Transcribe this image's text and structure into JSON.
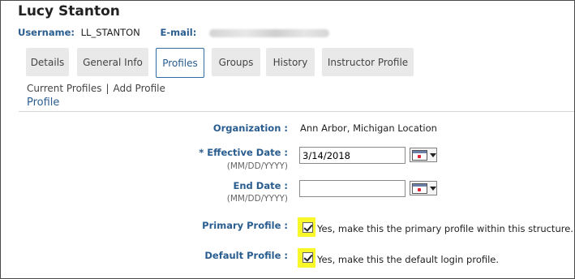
{
  "header": {
    "title": "Lucy Stanton",
    "username_label": "Username:",
    "username_value": "LL_STANTON",
    "email_label": "E-mail:"
  },
  "tabs": [
    {
      "label": "Details",
      "active": false
    },
    {
      "label": "General Info",
      "active": false
    },
    {
      "label": "Profiles",
      "active": true
    },
    {
      "label": "Groups",
      "active": false
    },
    {
      "label": "History",
      "active": false
    },
    {
      "label": "Instructor Profile",
      "active": false
    }
  ],
  "subnav": {
    "current": "Current Profiles",
    "separator": "|",
    "add": "Add Profile"
  },
  "section_title": "Profile",
  "form": {
    "organization": {
      "label": "Organization :",
      "value": "Ann Arbor, Michigan Location"
    },
    "effective_date": {
      "label": "* Effective Date :",
      "hint": "(MM/DD/YYYY)",
      "value": "3/14/2018"
    },
    "end_date": {
      "label": "End Date :",
      "hint": "(MM/DD/YYYY)",
      "value": ""
    },
    "primary_profile": {
      "label": "Primary Profile :",
      "checked": true,
      "text": "Yes, make this the primary profile within this structure."
    },
    "default_profile": {
      "label": "Default Profile :",
      "checked": true,
      "text": "Yes, make this the default login profile."
    }
  },
  "colors": {
    "accent": "#2a5d8f",
    "highlight": "#f7f72a",
    "tab_bg": "#e9e9e9"
  },
  "icons": {
    "calendar": "calendar-dropdown-icon",
    "check": "checkmark-icon"
  }
}
